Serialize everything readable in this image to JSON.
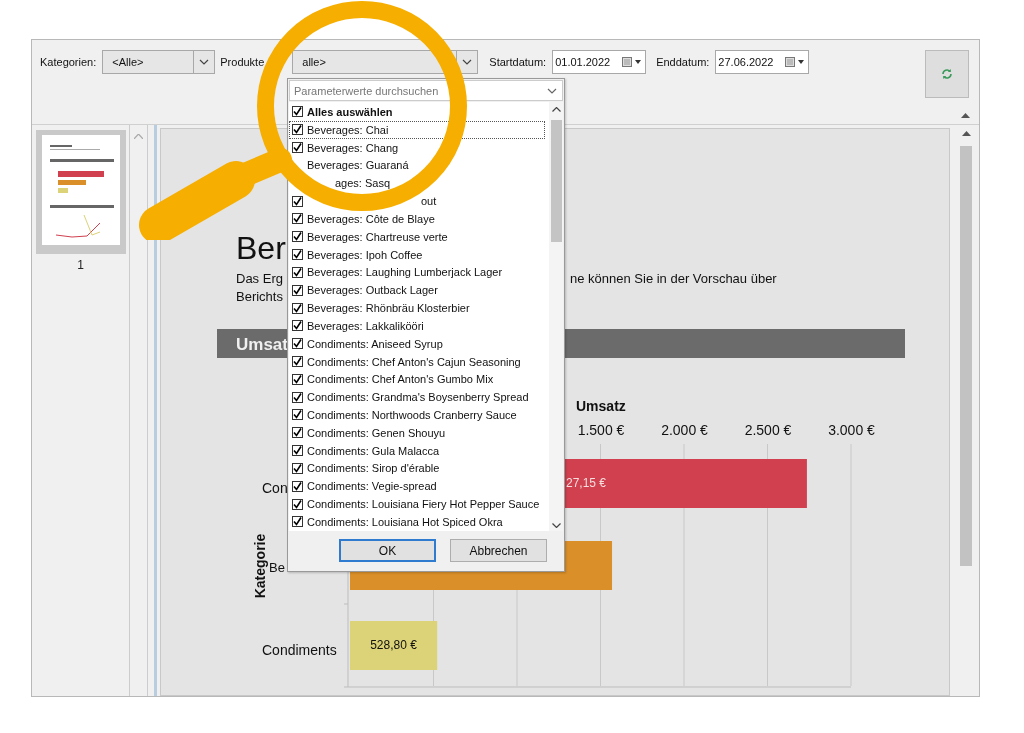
{
  "toolbar": {
    "fields": [
      {
        "label": "Kategorien:",
        "value": "<Alle>",
        "kind": "combo"
      },
      {
        "label": "Produkte",
        "value": "alle>",
        "kind": "combo"
      },
      {
        "label": "Startdatum:",
        "value": "01.01.2022",
        "kind": "date"
      },
      {
        "label": "Enddatum:",
        "value": "27.06.2022",
        "kind": "date"
      }
    ]
  },
  "thumbnails": [
    {
      "page": "1",
      "selected": true
    }
  ],
  "report": {
    "title": "Ber",
    "intro_start": "Das Erg",
    "intro_end": "ne können Sie in der Vorschau über",
    "intro_line_2": "Berichts",
    "section_header": "Umsat",
    "chart": {
      "title": "Umsatz",
      "ticks": [
        "1.500 €",
        "2.000 €",
        "2.500 €",
        "3.000 €"
      ],
      "y_axis_title": "Kategorie",
      "bars": [
        {
          "category": "Con",
          "label": "27,15 €",
          "level": 0.912,
          "color": "#d0404f"
        },
        {
          "category": "Be",
          "level": 0.523,
          "color": "#da8f28"
        },
        {
          "category": "Condiments",
          "label": "528,80 €",
          "level": 0.174,
          "color": "#dcd278"
        }
      ]
    }
  },
  "popup": {
    "search_placeholder": "Parameterwerte durchsuchen",
    "select_all": {
      "label": "Alles auswählen",
      "checked": true
    },
    "items": [
      {
        "label": "Beverages: Chai",
        "checked": true,
        "focused": true
      },
      {
        "label": "Beverages: Chang",
        "checked": true,
        "focused": false
      },
      {
        "label": "Beverages: Guaraná",
        "focused": false
      },
      {
        "label": "ages: Sasq",
        "focused": false
      },
      {
        "label": "out",
        "checked": true,
        "focused": false
      },
      {
        "label": "Beverages: Côte de Blaye",
        "checked": true,
        "focused": false
      },
      {
        "label": "Beverages: Chartreuse verte",
        "checked": true,
        "focused": false
      },
      {
        "label": "Beverages: Ipoh Coffee",
        "checked": true,
        "focused": false
      },
      {
        "label": "Beverages: Laughing Lumberjack Lager",
        "checked": true,
        "focused": false
      },
      {
        "label": "Beverages: Outback Lager",
        "checked": true,
        "focused": false
      },
      {
        "label": "Beverages: Rhönbräu Klosterbier",
        "checked": true,
        "focused": false
      },
      {
        "label": "Beverages: Lakkalikööri",
        "checked": true,
        "focused": false
      },
      {
        "label": "Condiments: Aniseed Syrup",
        "checked": true,
        "focused": false
      },
      {
        "label": "Condiments: Chef Anton's Cajun Seasoning",
        "checked": true,
        "focused": false
      },
      {
        "label": "Condiments: Chef Anton's Gumbo Mix",
        "checked": true,
        "focused": false
      },
      {
        "label": "Condiments: Grandma's Boysenberry Spread",
        "checked": true,
        "focused": false
      },
      {
        "label": "Condiments: Northwoods Cranberry Sauce",
        "checked": true,
        "focused": false
      },
      {
        "label": "Condiments: Genen Shouyu",
        "checked": true,
        "focused": false
      },
      {
        "label": "Condiments: Gula Malacca",
        "checked": true,
        "focused": false
      },
      {
        "label": "Condiments: Sirop d'érable",
        "checked": true,
        "focused": false
      },
      {
        "label": "Condiments: Vegie-spread",
        "checked": true,
        "focused": false
      },
      {
        "label": "Condiments: Louisiana Fiery Hot Pepper Sauce",
        "checked": true,
        "focused": false
      },
      {
        "label": "Condiments: Louisiana Hot Spiced Okra",
        "checked": true,
        "focused": false
      }
    ],
    "buttons": [
      {
        "label": "OK",
        "default": true
      },
      {
        "label": "Abbrechen",
        "default": false
      }
    ]
  }
}
